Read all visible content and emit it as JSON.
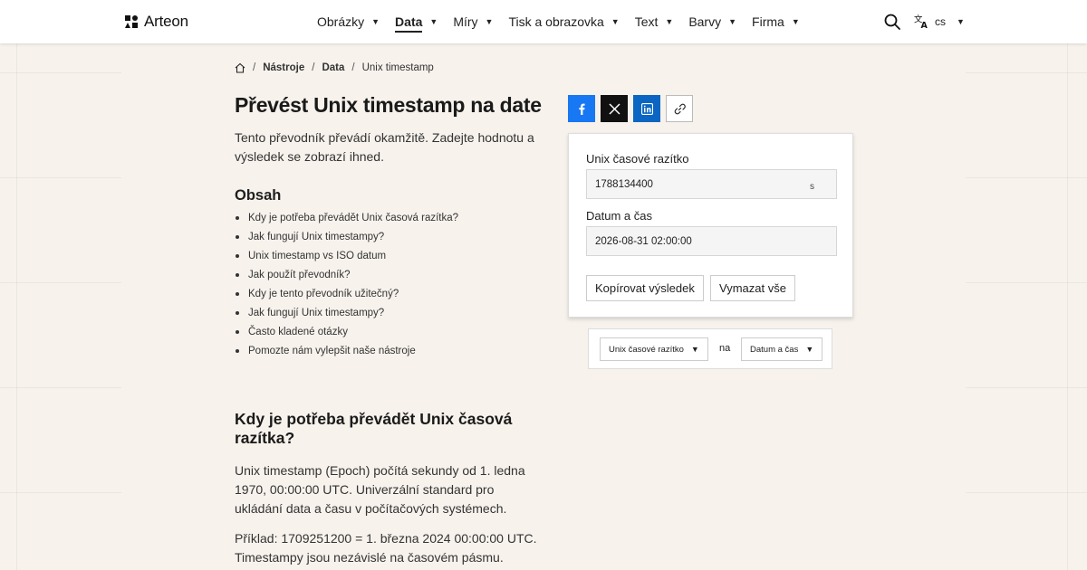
{
  "header": {
    "logo_text": "Arteon",
    "nav": [
      {
        "label": "Obrázky",
        "active": false
      },
      {
        "label": "Data",
        "active": true
      },
      {
        "label": "Míry",
        "active": false
      },
      {
        "label": "Tisk a obrazovka",
        "active": false
      },
      {
        "label": "Text",
        "active": false
      },
      {
        "label": "Barvy",
        "active": false
      },
      {
        "label": "Firma",
        "active": false
      }
    ],
    "language": "cs"
  },
  "breadcrumb": {
    "items": [
      "Nástroje",
      "Data",
      "Unix timestamp"
    ]
  },
  "page": {
    "title": "Převést Unix timestamp na date",
    "intro": "Tento převodník převádí okamžitě. Zadejte hodnotu a výsledek se zobrazí ihned."
  },
  "toc": {
    "title": "Obsah",
    "items": [
      "Kdy je potřeba převádět Unix časová razítka?",
      "Jak fungují Unix timestampy?",
      "Unix timestamp vs ISO datum",
      "Jak použít převodník?",
      "Kdy je tento převodník užitečný?",
      "Jak fungují Unix timestampy?",
      "Často kladené otázky",
      "Pomozte nám vylepšit naše nástroje"
    ]
  },
  "section": {
    "title": "Kdy je potřeba převádět Unix časová razítka?",
    "paragraphs": [
      "Unix timestamp (Epoch) počítá sekundy od 1. ledna 1970, 00:00:00 UTC. Univerzální standard pro ukládání data a času v počítačových systémech.",
      "Příklad: 1709251200 = 1. března 2024 00:00:00 UTC. Timestampy jsou nezávislé na časovém pásmu."
    ]
  },
  "converter": {
    "timestamp_label": "Unix časové razítko",
    "timestamp_value": "1788134400",
    "timestamp_unit": "s",
    "datetime_label": "Datum a čas",
    "datetime_value": "2026-08-31 02:00:00",
    "copy_button": "Kopírovat výsledek",
    "clear_button": "Vymazat vše"
  },
  "unit_selector": {
    "from": "Unix časové razítko",
    "connector": "na",
    "to": "Datum a čas"
  },
  "colors": {
    "facebook": "#1877f2",
    "x": "#111111",
    "linkedin": "#0a66c2",
    "background": "#f7f2ec"
  }
}
